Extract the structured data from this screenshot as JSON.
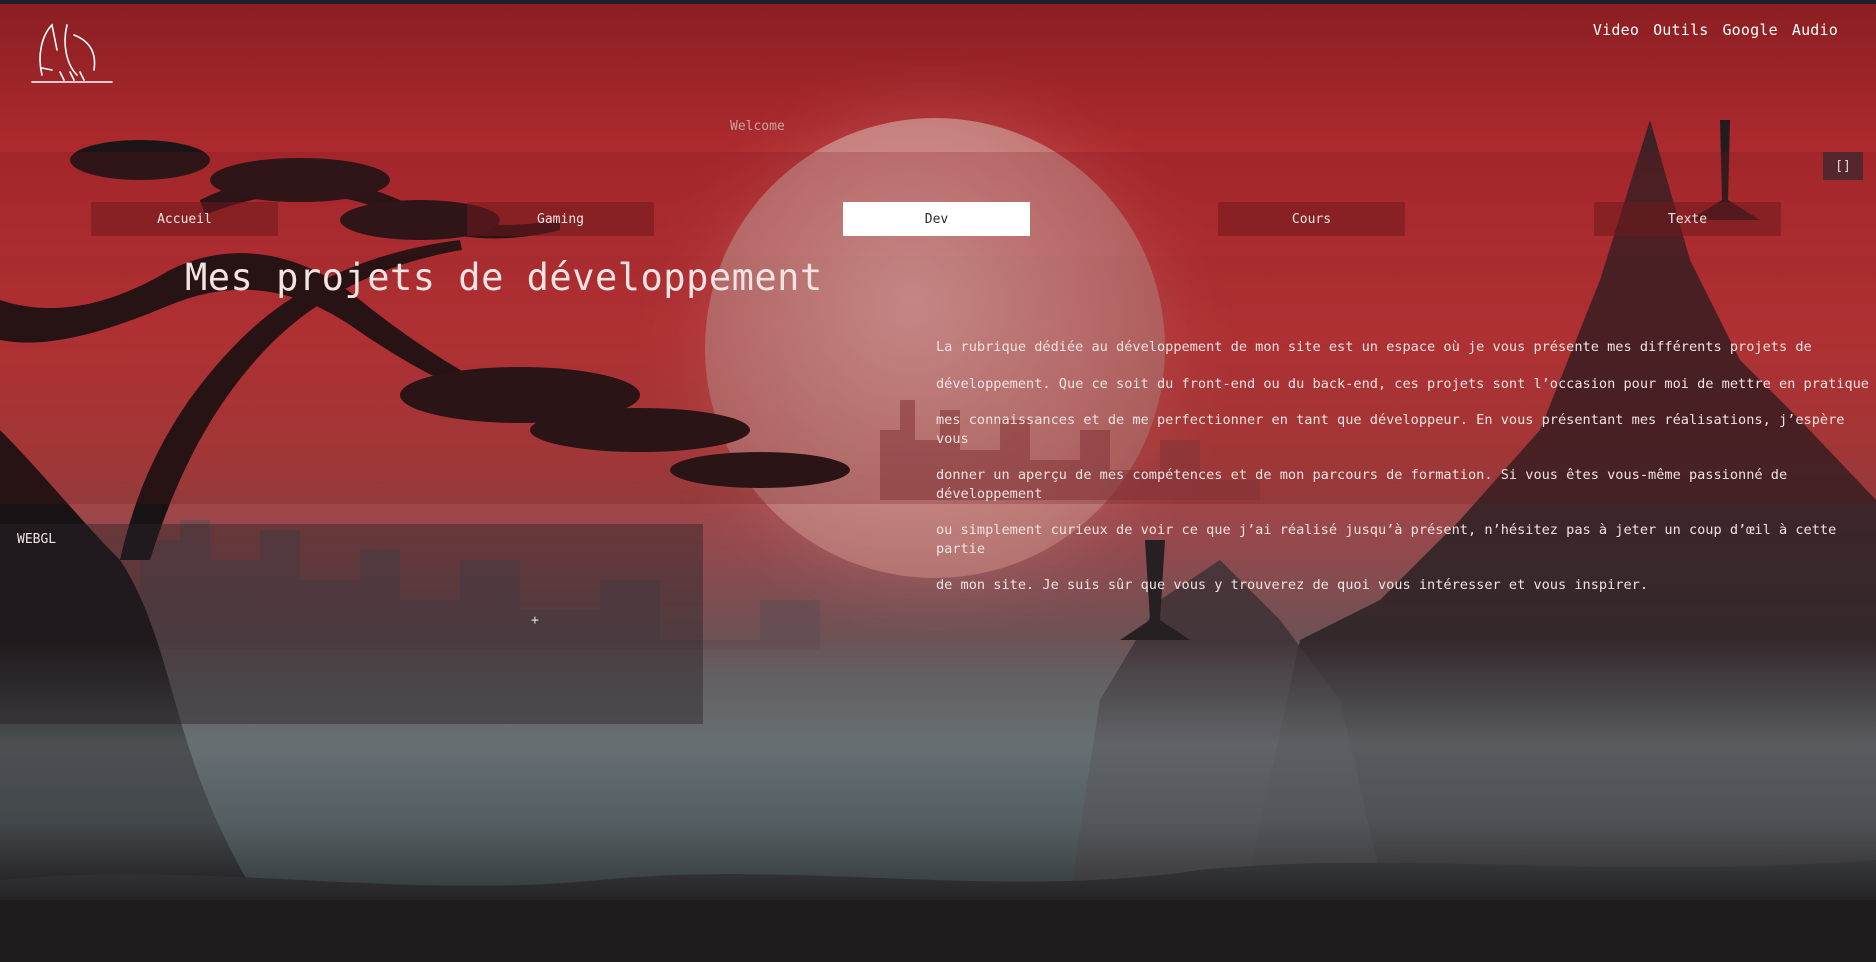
{
  "top_nav": {
    "items": [
      "Video",
      "Outils",
      "Google",
      "Audio"
    ]
  },
  "welcome": "Welcome",
  "fullscreen_label": "[]",
  "tabs": [
    {
      "label": "Accueil",
      "active": false
    },
    {
      "label": "Gaming",
      "active": false
    },
    {
      "label": "Dev",
      "active": true
    },
    {
      "label": "Cours",
      "active": false
    },
    {
      "label": "Texte",
      "active": false
    }
  ],
  "main": {
    "title": "Mes projets de développement",
    "description_lines": [
      "La rubrique dédiée au développement de mon site est un espace où je vous présente mes différents projets de",
      "développement. Que ce soit du front-end ou du back-end, ces projets sont l’occasion pour moi de mettre en pratique",
      "mes connaissances et de me perfectionner en tant que développeur. En vous présentant mes réalisations, j’espère vous",
      "donner un aperçu de mes compétences et de mon parcours de formation. Si vous êtes vous-même passionné de développement",
      "ou simplement curieux de voir ce que j’ai réalisé jusqu’à présent, n’hésitez pas à jeter un coup d’œil à cette partie",
      "de mon site. Je suis sûr que vous y trouverez de quoi vous intéresser et vous inspirer."
    ]
  },
  "webgl": {
    "label": "WEBGL",
    "cursor": "+"
  },
  "colors": {
    "accent": "#c4393b",
    "active_tab_bg": "#ffffff",
    "tab_bg": "#6e191e"
  }
}
